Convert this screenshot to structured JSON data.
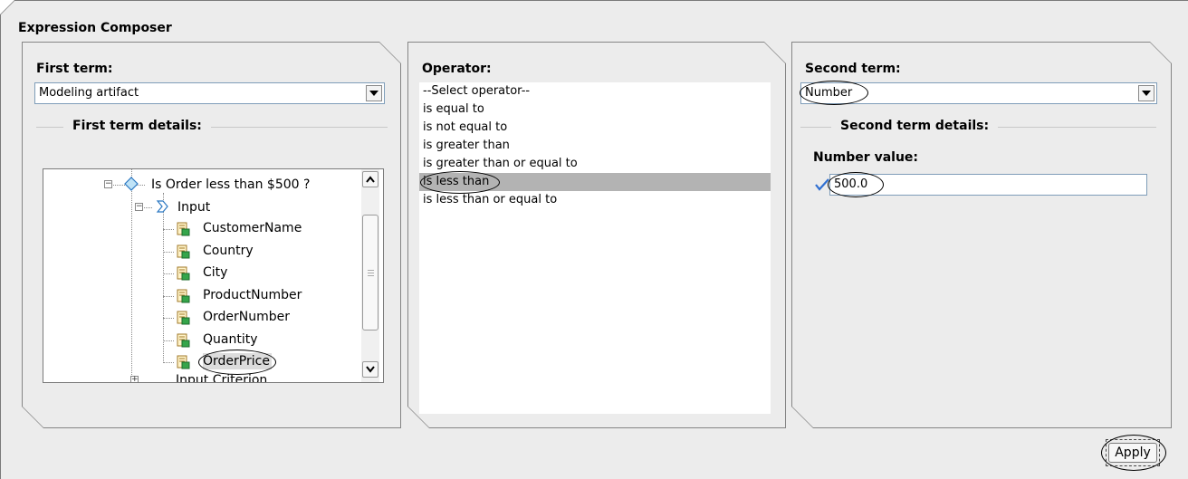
{
  "window": {
    "title": "Expression Composer"
  },
  "first_term": {
    "label": "First term:",
    "selected": "Modeling artifact",
    "details_label": "First term details:",
    "tree": {
      "root": "Is Order less than  $500 ?",
      "input_node": "Input",
      "fields": [
        "CustomerName",
        "Country",
        "City",
        "ProductNumber",
        "OrderNumber",
        "Quantity",
        "OrderPrice"
      ],
      "selected_field": "OrderPrice",
      "next_node": "Input Criterion"
    }
  },
  "operator": {
    "label": "Operator:",
    "options": [
      "--Select operator--",
      "is equal to",
      "is not equal to",
      "is greater than",
      "is greater than or equal to",
      "is less than",
      "is less than or equal to"
    ],
    "selected": "is less than"
  },
  "second_term": {
    "label": "Second term:",
    "selected": "Number",
    "details_label": "Second term details:",
    "value_label": "Number value:",
    "value": "500.0"
  },
  "buttons": {
    "apply": "Apply"
  },
  "icons": {
    "valid": "checkmark-icon",
    "field": "field-icon",
    "decision": "decision-icon",
    "input": "input-icon"
  }
}
